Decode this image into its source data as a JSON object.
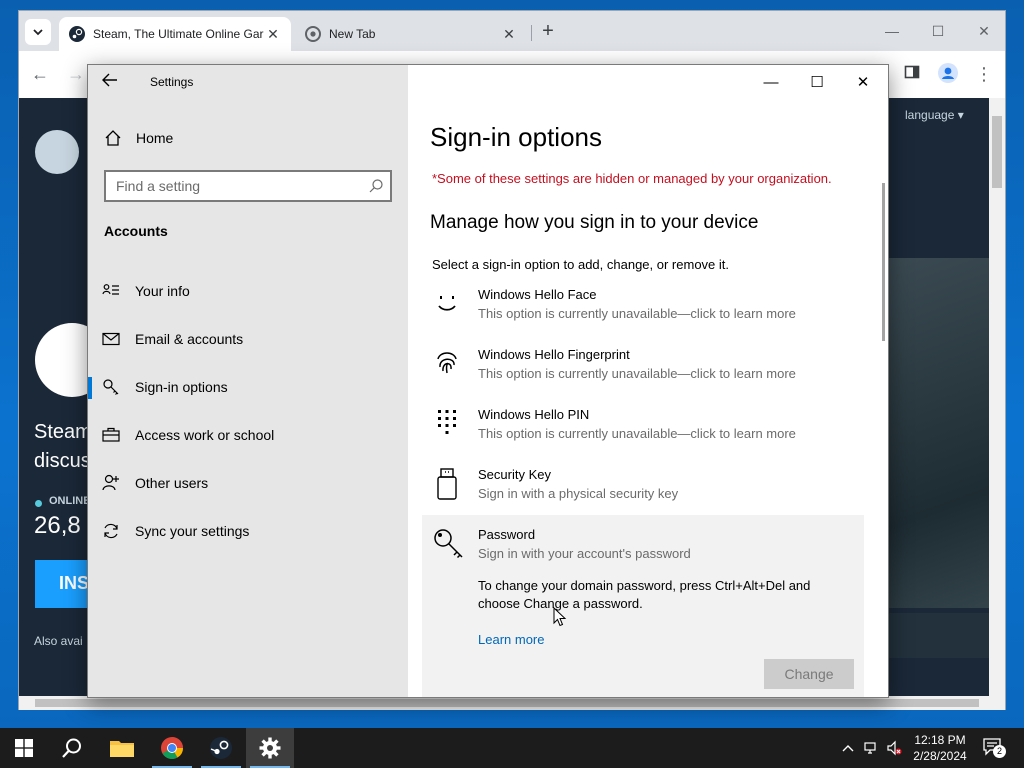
{
  "chrome": {
    "tabs": [
      {
        "title": "Steam, The Ultimate Online Gar",
        "close": "✕"
      },
      {
        "title": "New Tab",
        "close": "✕"
      }
    ],
    "new_tab": "+",
    "window_controls": {
      "minimize": "—",
      "maximize": "☐",
      "close": "✕"
    }
  },
  "steam_page": {
    "language": "language ▾",
    "headline_line1": "Steam",
    "headline_line2": "discus",
    "online_label": "ONLINE",
    "online_count": "26,8",
    "install_label": "INS",
    "also_available": "Also avai"
  },
  "settings": {
    "window_title": "Settings",
    "window_controls": {
      "minimize": "—",
      "maximize": "☐",
      "close": "✕"
    },
    "home_label": "Home",
    "search_placeholder": "Find a setting",
    "category": "Accounts",
    "nav": [
      {
        "label": "Your info",
        "icon": "your-info-icon"
      },
      {
        "label": "Email & accounts",
        "icon": "email-icon"
      },
      {
        "label": "Sign-in options",
        "icon": "key-icon",
        "active": true
      },
      {
        "label": "Access work or school",
        "icon": "briefcase-icon"
      },
      {
        "label": "Other users",
        "icon": "person-icon"
      },
      {
        "label": "Sync your settings",
        "icon": "sync-icon"
      }
    ],
    "page_title": "Sign-in options",
    "org_notice": "*Some of these settings are hidden or managed by your organization.",
    "section_title": "Manage how you sign in to your device",
    "section_desc": "Select a sign-in option to add, change, or remove it.",
    "options": [
      {
        "name": "Windows Hello Face",
        "sub": "This option is currently unavailable—click to learn more",
        "icon": "face-icon"
      },
      {
        "name": "Windows Hello Fingerprint",
        "sub": "This option is currently unavailable—click to learn more",
        "icon": "fingerprint-icon"
      },
      {
        "name": "Windows Hello PIN",
        "sub": "This option is currently unavailable—click to learn more",
        "icon": "pin-keypad-icon"
      },
      {
        "name": "Security Key",
        "sub": "Sign in with a physical security key",
        "icon": "usb-key-icon"
      }
    ],
    "password": {
      "name": "Password",
      "sub": "Sign in with your account's password",
      "info": "To change your domain password, press Ctrl+Alt+Del and choose Change a password.",
      "learn_more": "Learn more",
      "change_button": "Change"
    }
  },
  "taskbar": {
    "time": "12:18 PM",
    "date": "2/28/2024",
    "notifications": "2"
  }
}
